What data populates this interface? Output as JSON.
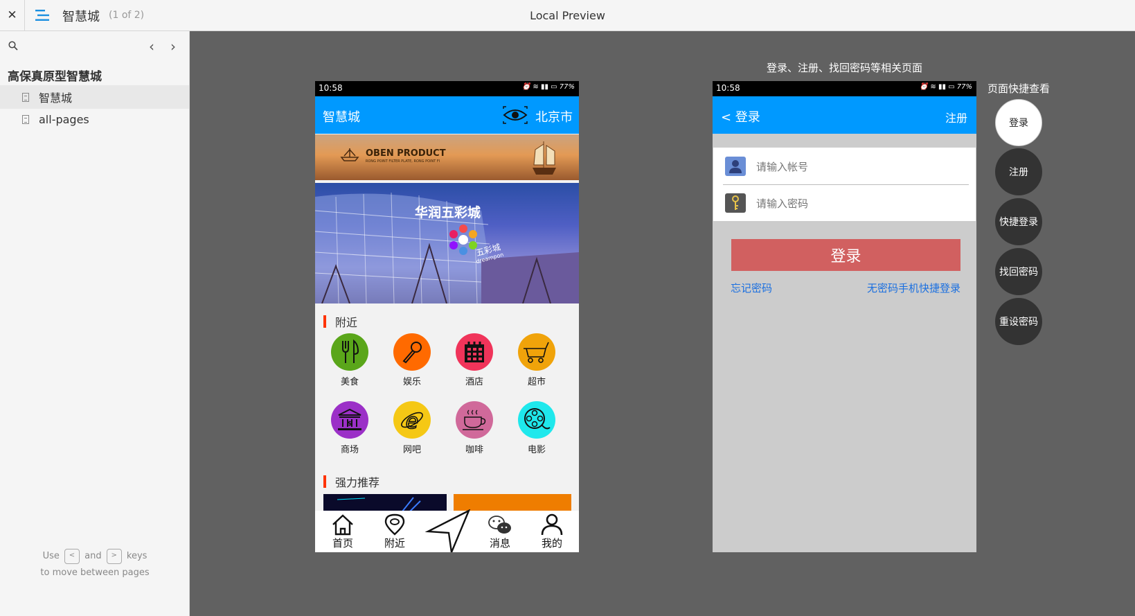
{
  "topbar": {
    "close_glyph": "✕",
    "project_title": "智慧城",
    "page_count": "(1 of 2)",
    "center_title": "Local Preview"
  },
  "sidebar": {
    "prev_glyph": "‹",
    "next_glyph": "›",
    "project_heading": "高保真原型智慧城",
    "pages": [
      {
        "label": "智慧城",
        "active": true
      },
      {
        "label": "all-pages",
        "active": false
      }
    ],
    "help_use": "Use",
    "help_and": "and",
    "help_keys": "keys",
    "help_line2": "to move between pages",
    "key_left": "<",
    "key_right": ">"
  },
  "home_screen": {
    "status_time": "10:58",
    "status_battery": "77%",
    "app_title": "智慧城",
    "city": "北京市",
    "banner_text": "OBEN PRODUCT",
    "banner_sub": "RONG POINT FILTER PLATE, RONG POINT FI",
    "mall_title": "华润五彩城",
    "mall_logo_text": "五彩城",
    "mall_logo_sub": "dreampon",
    "nearby_heading": "附近",
    "categories": [
      {
        "label": "美食",
        "icon": "fork-knife-icon",
        "color": "#5aa61a"
      },
      {
        "label": "娱乐",
        "icon": "microphone-icon",
        "color": "#ff6a00"
      },
      {
        "label": "酒店",
        "icon": "hotel-icon",
        "color": "#f0345a"
      },
      {
        "label": "超市",
        "icon": "cart-icon",
        "color": "#f0a30a"
      },
      {
        "label": "商场",
        "icon": "bank-icon",
        "color": "#9b30c7"
      },
      {
        "label": "网吧",
        "icon": "internet-icon",
        "color": "#f5c815"
      },
      {
        "label": "咖啡",
        "icon": "coffee-icon",
        "color": "#d0699a"
      },
      {
        "label": "电影",
        "icon": "film-reel-icon",
        "color": "#1fe8ec"
      }
    ],
    "recommend_heading": "强力推荐",
    "tabs": [
      {
        "label": "首页",
        "icon": "home-icon"
      },
      {
        "label": "附近",
        "icon": "location-pin-icon"
      },
      {
        "label": "",
        "icon": "navigation-arrow-icon"
      },
      {
        "label": "消息",
        "icon": "chat-icon"
      },
      {
        "label": "我的",
        "icon": "user-icon"
      }
    ]
  },
  "login_screen": {
    "caption": "登录、注册、找回密码等相关页面",
    "status_time": "10:58",
    "status_battery": "77%",
    "back_label": "< 登录",
    "register_link": "注册",
    "account_placeholder": "请输入帐号",
    "password_placeholder": "请输入密码",
    "login_button": "登录",
    "forgot_link": "忘记密码",
    "quick_login_link": "无密码手机快捷登录"
  },
  "quick_view": {
    "heading": "页面快捷查看",
    "items": [
      {
        "label": "登录",
        "active": true
      },
      {
        "label": "注册",
        "active": false
      },
      {
        "label": "快捷登录",
        "active": false
      },
      {
        "label": "找回密码",
        "active": false
      },
      {
        "label": "重设密码",
        "active": false
      }
    ]
  }
}
